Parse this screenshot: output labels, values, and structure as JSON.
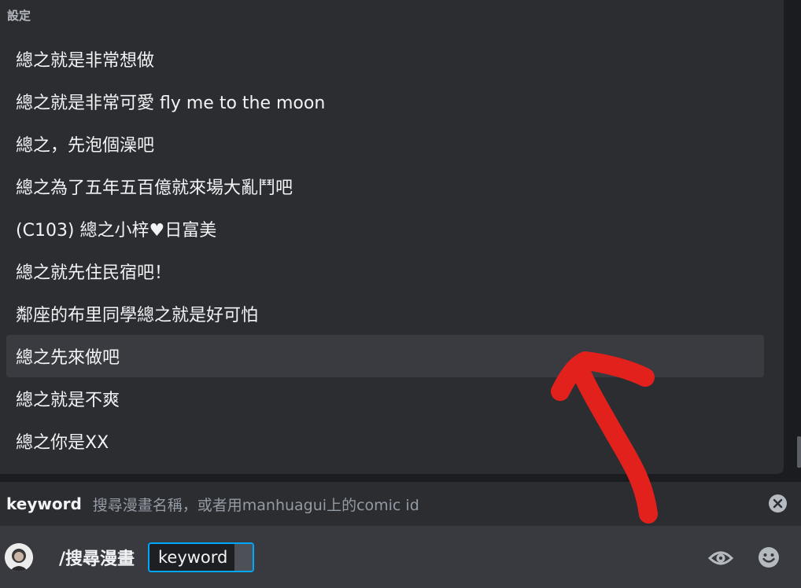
{
  "popup": {
    "header": "設定",
    "options": [
      {
        "label": "總之就是非常想做"
      },
      {
        "label": "總之就是非常可愛 fly me to the moon"
      },
      {
        "label": "總之，先泡個澡吧"
      },
      {
        "label": "總之為了五年五百億就來場大亂鬥吧"
      },
      {
        "label": "(C103) 總之小梓♥日富美"
      },
      {
        "label": "總之就先住民宿吧！"
      },
      {
        "label": "鄰座的布里同學總之就是好可怕"
      },
      {
        "label": "總之先來做吧"
      },
      {
        "label": "總之就是不爽"
      },
      {
        "label": "總之你是XX"
      }
    ],
    "selected_index": 7
  },
  "param_hint": {
    "name": "keyword",
    "description": "搜尋漫畫名稱，或者用manhuagui上的comic id",
    "close_icon": "close-circle-icon"
  },
  "input_bar": {
    "command": "/搜尋漫畫",
    "option_label": "keyword",
    "eye_icon": "eye-icon",
    "emoji_icon": "emoji-icon"
  },
  "colors": {
    "popup_bg": "#2b2d31",
    "selected_bg": "#393b41",
    "input_bg": "#383a40",
    "focus_border": "#00a8fc",
    "annotation_red": "#e3211c"
  }
}
